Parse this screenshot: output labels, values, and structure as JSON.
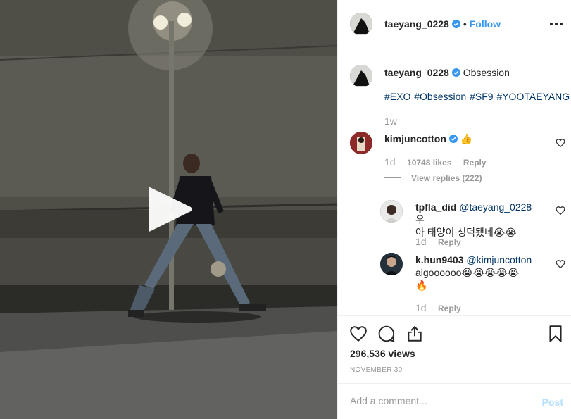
{
  "post": {
    "author": "taeyang_0228",
    "follow_label": "Follow",
    "dot": "•",
    "caption": "Obsession",
    "hashtags": [
      "#EXO",
      "#Obsession",
      "#SF9",
      "#YOOTAEYANG"
    ],
    "age": "1w"
  },
  "comments": [
    {
      "user": "kimjuncotton",
      "text": "👍",
      "age": "1d",
      "likes": "10748 likes",
      "reply": "Reply",
      "view_replies": "View replies (222)"
    }
  ],
  "replies": [
    {
      "user": "tpfla_did",
      "mention": "@taeyang_0228",
      "text_line1": "우",
      "text_line2": "아 태양이 성덕됐네😭😭",
      "age": "1d",
      "reply": "Reply"
    },
    {
      "user": "k.hun9403",
      "mention": "@kimjuncotton",
      "text_line1": "aigoooooo😭😭😭😭😭",
      "text_line2": "🔥",
      "age": "1d",
      "reply": "Reply"
    }
  ],
  "stats": {
    "views": "296,536 views",
    "date": "NOVEMBER 30"
  },
  "compose": {
    "placeholder": "Add a comment...",
    "post_label": "Post"
  },
  "colors": {
    "link": "#3897f0",
    "hashtag": "#003569",
    "muted": "#999999",
    "post_disabled": "#b2dffc"
  },
  "icons": [
    "play-icon",
    "more-icon",
    "verified-icon",
    "heart-icon",
    "comment-icon",
    "share-icon",
    "bookmark-icon"
  ]
}
